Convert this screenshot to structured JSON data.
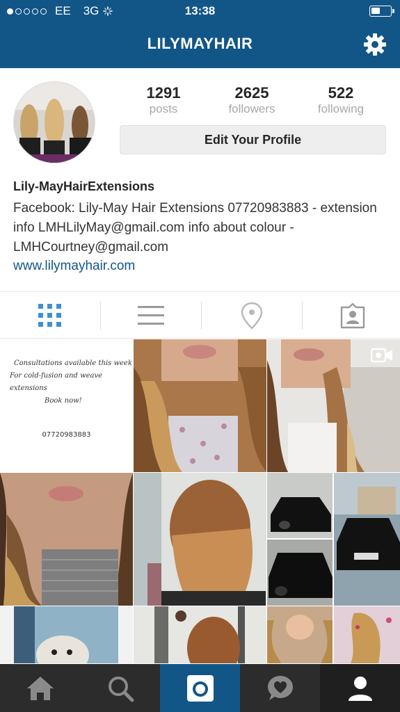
{
  "status_bar": {
    "carrier": "EE",
    "network": "3G",
    "time": "13:38",
    "signal_bars_filled": 1,
    "signal_bars_total": 5
  },
  "header": {
    "title": "LILYMAYHAIR",
    "settings_icon": "gear-icon"
  },
  "profile": {
    "stats": [
      {
        "value": "1291",
        "label": "posts"
      },
      {
        "value": "2625",
        "label": "followers"
      },
      {
        "value": "522",
        "label": "following"
      }
    ],
    "edit_button": "Edit Your Profile",
    "name": "Lily-MayHairExtensions",
    "bio": "Facebook: Lily-May Hair Extensions 07720983883 - extension info LMHLilyMay@gmail.com info about colour - LMHCourtney@gmail.com",
    "website": "www.lilymayhair.com"
  },
  "view_toggles": [
    {
      "name": "grid-view",
      "icon": "grid-icon",
      "active": true
    },
    {
      "name": "list-view",
      "icon": "list-icon",
      "active": false
    },
    {
      "name": "map-view",
      "icon": "location-pin-icon",
      "active": false
    },
    {
      "name": "tagged-view",
      "icon": "tagged-person-icon",
      "active": false
    }
  ],
  "posts": {
    "promo": {
      "line1": "Consultations available this week",
      "line2": "For cold-fusion and weave extensions",
      "line3": "Book now!",
      "phone": "07720983883"
    }
  },
  "tabbar": [
    {
      "name": "home",
      "icon": "home-icon"
    },
    {
      "name": "search",
      "icon": "search-icon"
    },
    {
      "name": "camera",
      "icon": "camera-icon"
    },
    {
      "name": "activity",
      "icon": "heart-bubble-icon"
    },
    {
      "name": "profile",
      "icon": "person-icon"
    }
  ],
  "colors": {
    "brand_blue": "#125688",
    "tabbar_bg": "#2c2c2c",
    "link": "#125688"
  }
}
